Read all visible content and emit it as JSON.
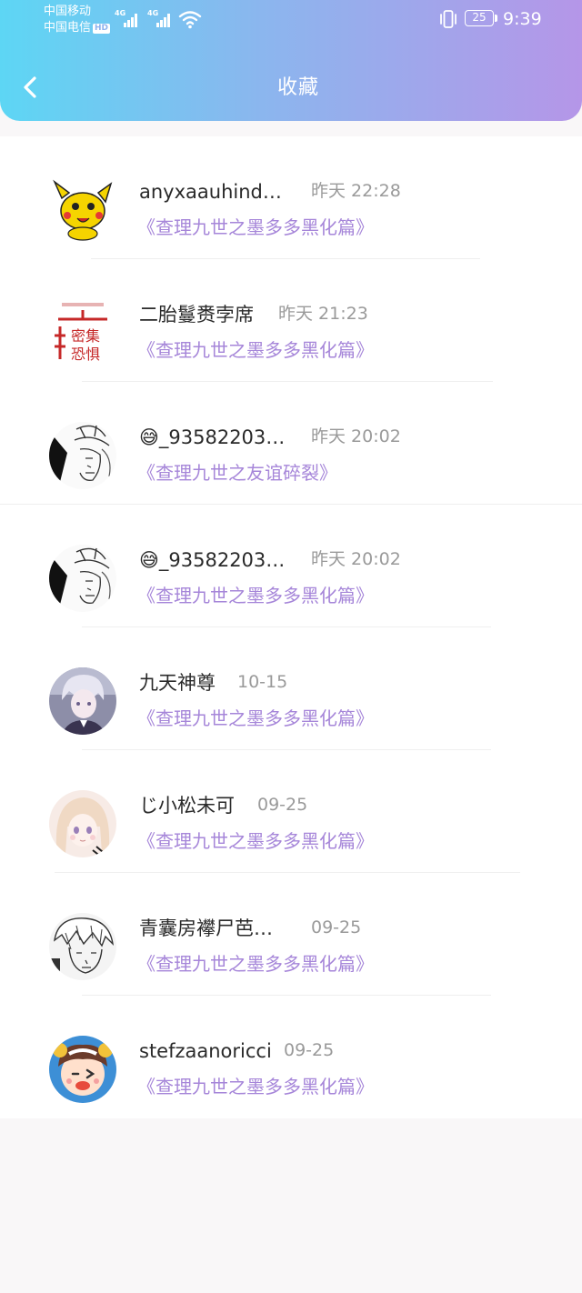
{
  "status_bar": {
    "carrier_1": "中国移动",
    "carrier_2": "中国电信",
    "hd_badge": "HD",
    "net_1": "4G",
    "net_2": "4G",
    "battery": "25",
    "time": "9:39"
  },
  "header": {
    "title": "收藏",
    "gradient": [
      "#5dd6f4",
      "#b596e8"
    ]
  },
  "favorites": [
    {
      "name": "anyxaauhind…",
      "time": "昨天 22:28",
      "book": "《查理九世之墨多多黑化篇》",
      "avatar": "yellow-creature-avatar"
    },
    {
      "name": "二胎鬘赉孛席",
      "time": "昨天 21:23",
      "book": "《查理九世之墨多多黑化篇》",
      "avatar": "red-calligraphy-avatar"
    },
    {
      "name": "😅_93582203…",
      "time": "昨天 20:02",
      "book": "《查理九世之友谊碎裂》",
      "avatar": "manga-sketch-avatar"
    },
    {
      "name": "😅_93582203…",
      "time": "昨天 20:02",
      "book": "《查理九世之墨多多黑化篇》",
      "avatar": "manga-sketch-avatar"
    },
    {
      "name": "九天神尊",
      "time": "10-15",
      "book": "《查理九世之墨多多黑化篇》",
      "avatar": "silver-hair-anime-avatar"
    },
    {
      "name": "じ小松未可",
      "time": "09-25",
      "book": "《查理九世之墨多多黑化篇》",
      "avatar": "pastel-anime-girl-avatar"
    },
    {
      "name": "青囊房襻尸芭…",
      "time": "09-25",
      "book": "《查理九世之墨多多黑化篇》",
      "avatar": "manga-boy-avatar"
    },
    {
      "name": "stefzaanoricci",
      "time": "09-25",
      "book": "《查理九世之墨多多黑化篇》",
      "avatar": "winking-cartoon-avatar"
    }
  ],
  "colors": {
    "accent_text": "#a686d9",
    "name_text": "#2a2a2a",
    "time_text": "#9a9a9a"
  }
}
